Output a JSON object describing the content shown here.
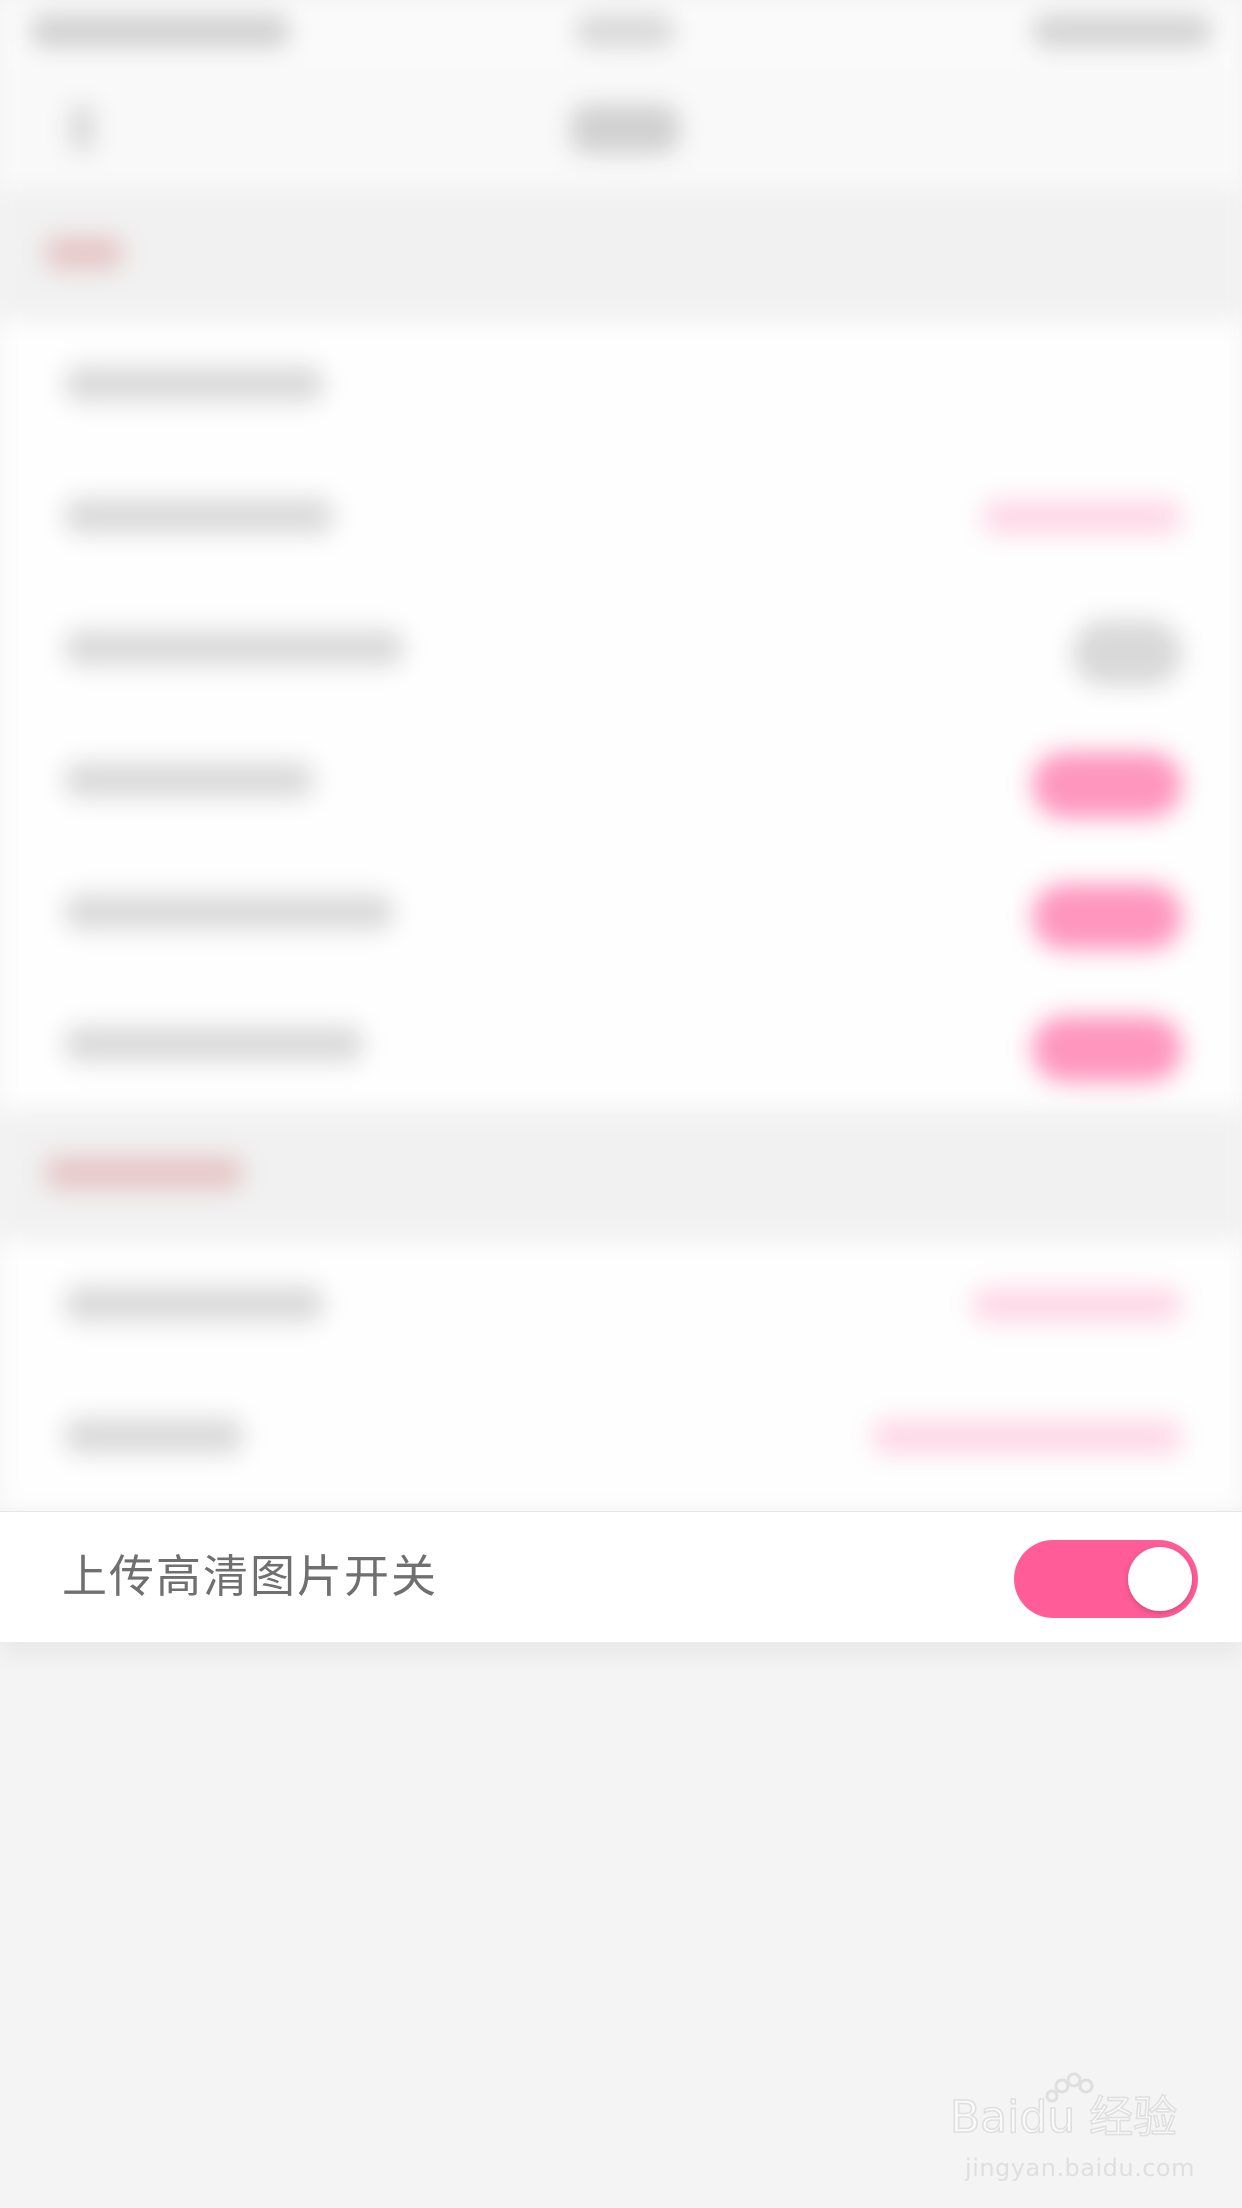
{
  "setting": {
    "hd_upload_label": "上传高清图片开关",
    "hd_upload_enabled": true
  },
  "watermark": {
    "brand": "Baidu 经验",
    "url": "jingyan.baidu.com"
  },
  "colors": {
    "toggle_on": "#ff5c98",
    "background": "#f4f4f4",
    "label_text": "#6f6f6f"
  }
}
